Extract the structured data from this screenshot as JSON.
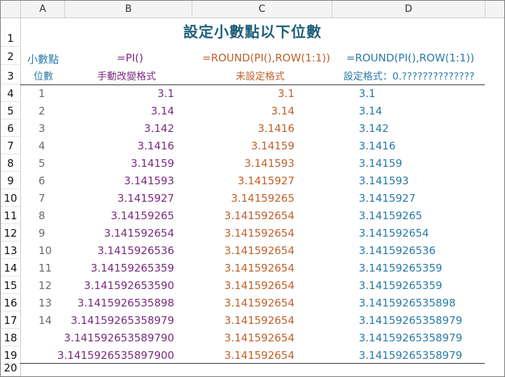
{
  "column_headers": [
    "A",
    "B",
    "C",
    "D"
  ],
  "row_numbers": [
    "1",
    "2",
    "3",
    "4",
    "5",
    "6",
    "7",
    "8",
    "9",
    "10",
    "11",
    "12",
    "13",
    "14",
    "15",
    "16",
    "17",
    "18",
    "19",
    "20"
  ],
  "title": "設定小數點以下位數",
  "row2": {
    "a": "小數點",
    "b": "=PI()",
    "c": "=ROUND(PI(),ROW(1:1))",
    "d": "=ROUND(PI(),ROW(1:1))"
  },
  "row3": {
    "a": "位數",
    "b": "手動改變格式",
    "c": "未設定格式",
    "d": "設定格式：0.??????????????"
  },
  "rows": [
    {
      "a": "1",
      "b": "3.1",
      "c": "3.1",
      "d": "3.1"
    },
    {
      "a": "2",
      "b": "3.14",
      "c": "3.14",
      "d": "3.14"
    },
    {
      "a": "3",
      "b": "3.142",
      "c": "3.1416",
      "d": "3.142"
    },
    {
      "a": "4",
      "b": "3.1416",
      "c": "3.14159",
      "d": "3.1416"
    },
    {
      "a": "5",
      "b": "3.14159",
      "c": "3.141593",
      "d": "3.14159"
    },
    {
      "a": "6",
      "b": "3.141593",
      "c": "3.1415927",
      "d": "3.141593"
    },
    {
      "a": "7",
      "b": "3.1415927",
      "c": "3.14159265",
      "d": "3.1415927"
    },
    {
      "a": "8",
      "b": "3.14159265",
      "c": "3.141592654",
      "d": "3.14159265"
    },
    {
      "a": "9",
      "b": "3.141592654",
      "c": "3.141592654",
      "d": "3.141592654"
    },
    {
      "a": "10",
      "b": "3.1415926536",
      "c": "3.141592654",
      "d": "3.1415926536"
    },
    {
      "a": "11",
      "b": "3.14159265359",
      "c": "3.141592654",
      "d": "3.14159265359"
    },
    {
      "a": "12",
      "b": "3.141592653590",
      "c": "3.141592654",
      "d": "3.14159265359"
    },
    {
      "a": "13",
      "b": "3.1415926535898",
      "c": "3.141592654",
      "d": "3.1415926535898"
    },
    {
      "a": "14",
      "b": "3.14159265358979",
      "c": "3.141592654",
      "d": "3.14159265358979"
    },
    {
      "a": "",
      "b": "3.141592653589790",
      "c": "3.141592654",
      "d": "3.14159265358979"
    },
    {
      "a": "",
      "b": "3.1415926535897900",
      "c": "3.141592654",
      "d": "3.14159265358979"
    }
  ],
  "colors": {
    "purple": "#7a2a7f",
    "orange": "#c0602a",
    "blue": "#2a7aa8",
    "gray": "#6b6b6b",
    "title": "#1f5f7a"
  }
}
